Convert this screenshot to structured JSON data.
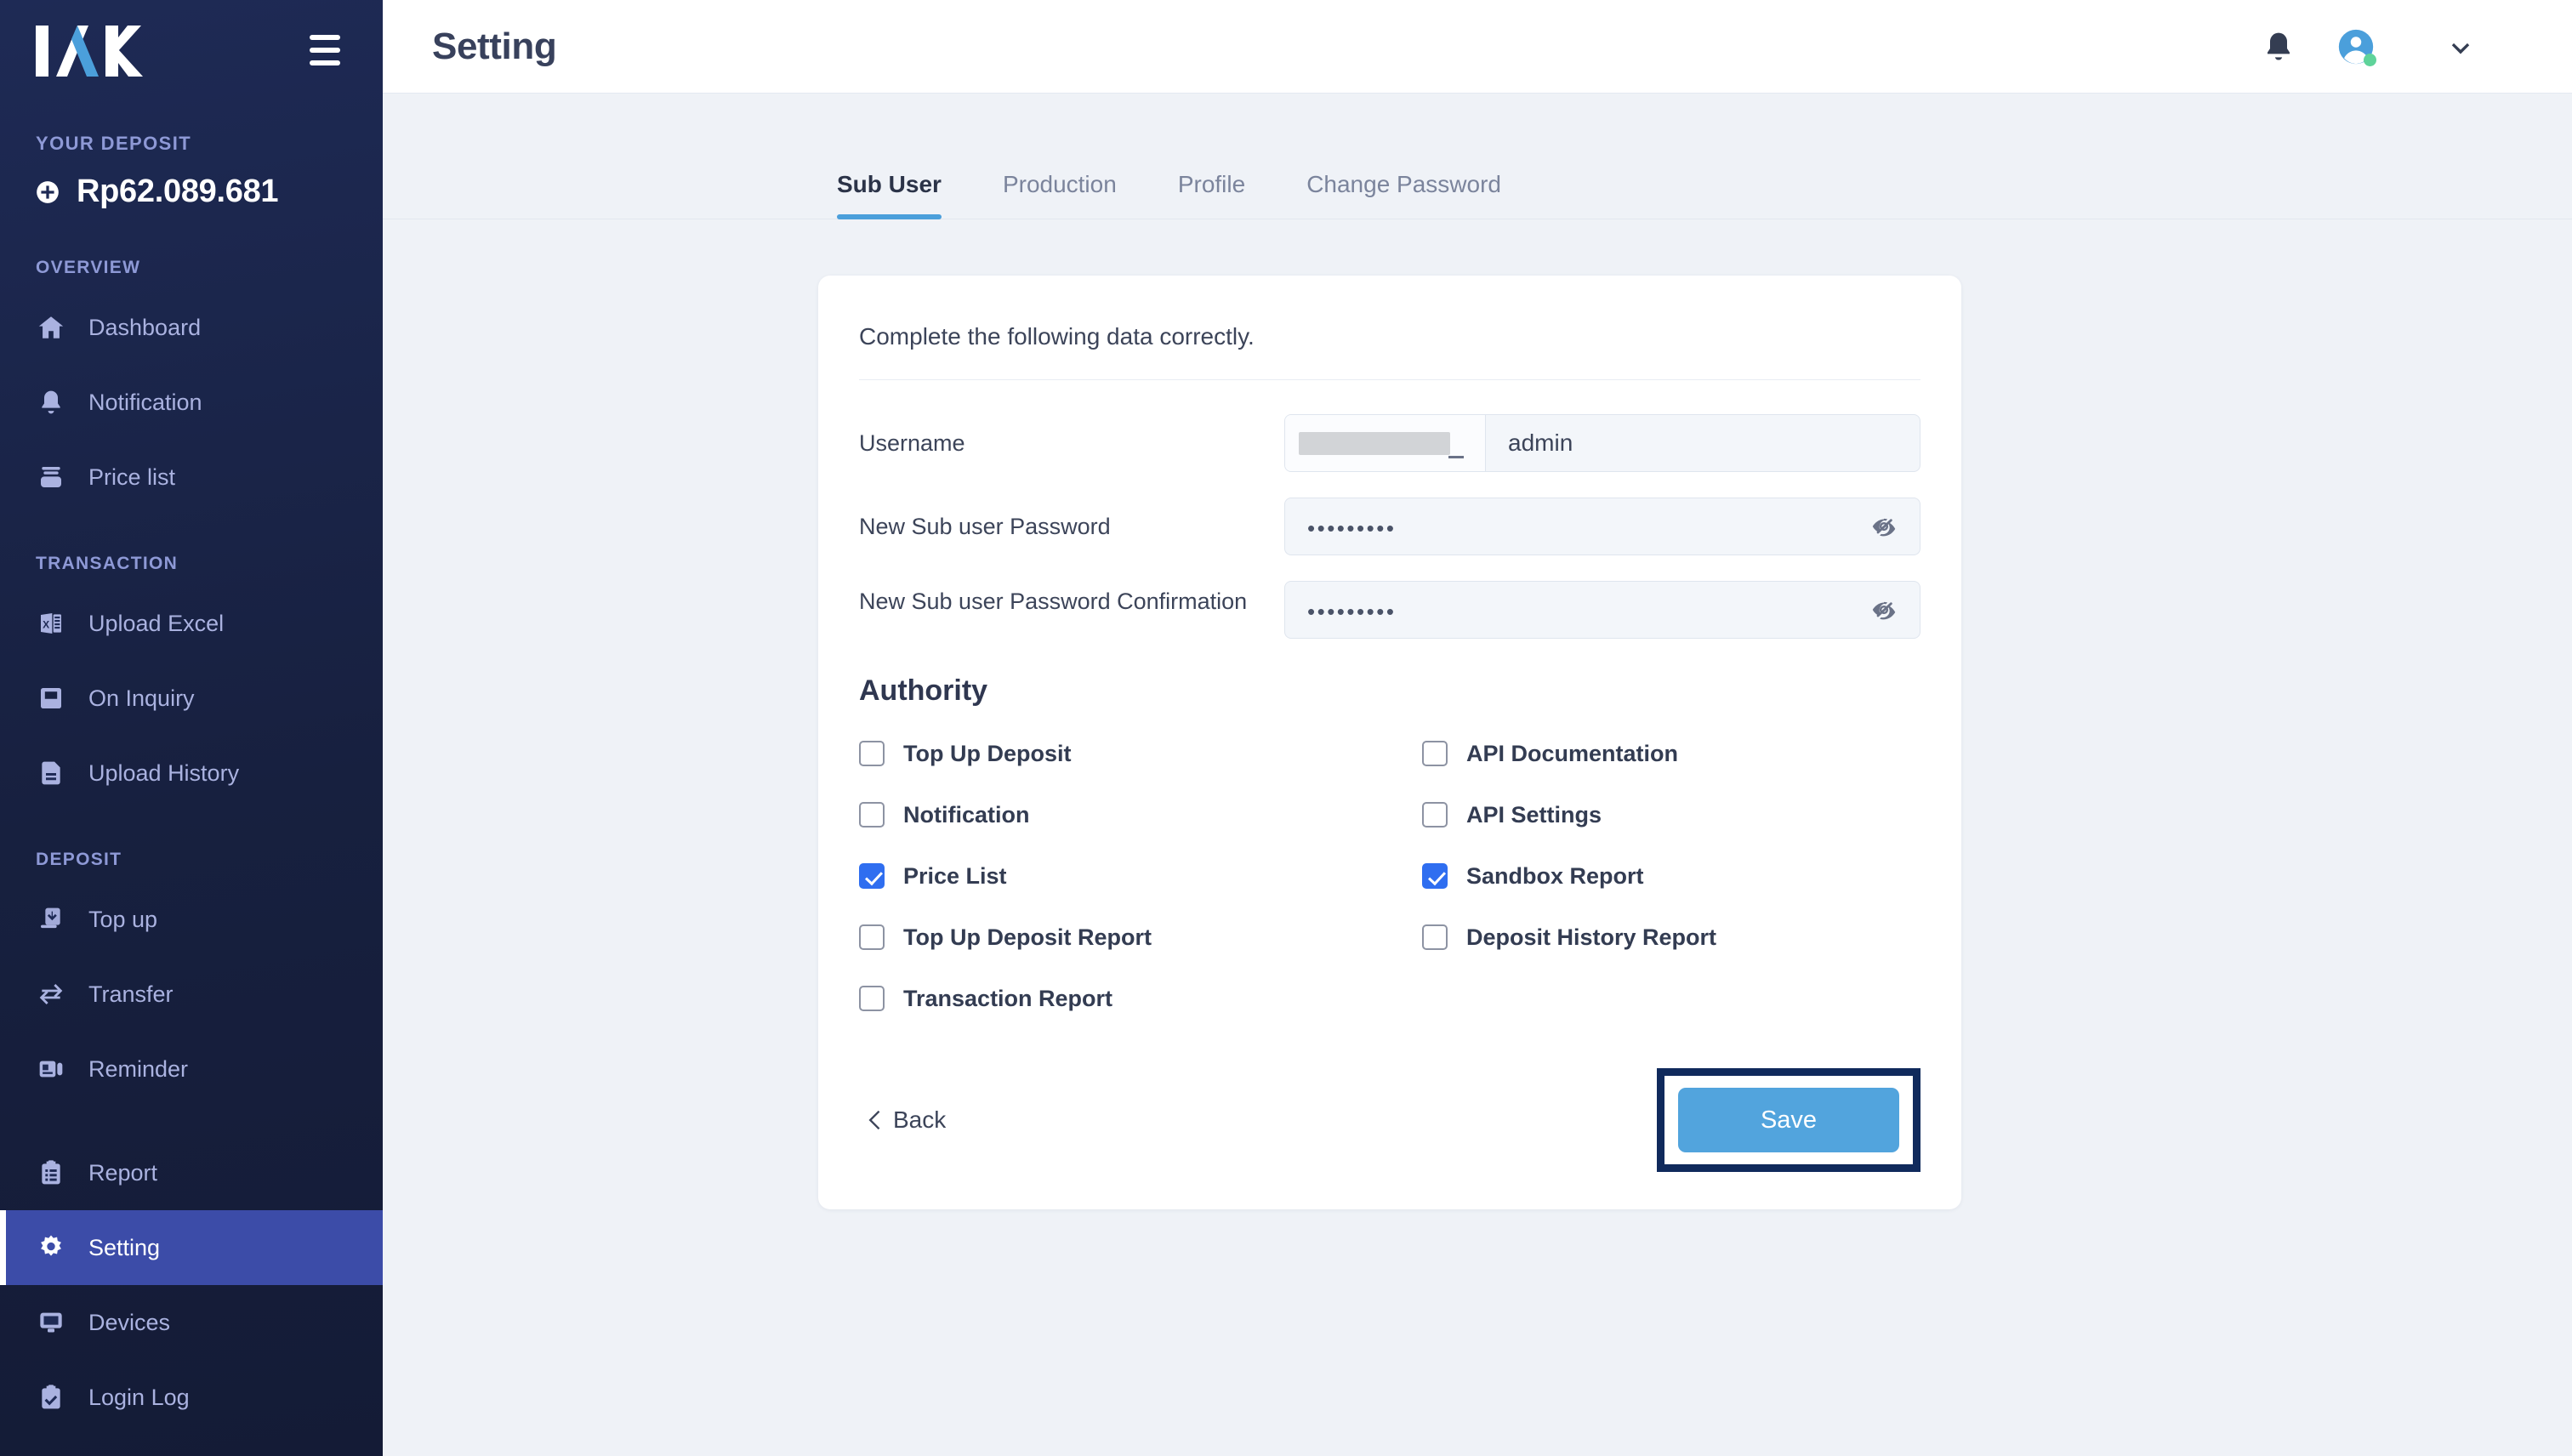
{
  "sidebar": {
    "logo_text": "IAK",
    "deposit_label": "YOUR DEPOSIT",
    "deposit_amount": "Rp62.089.681",
    "sections": [
      {
        "label": "OVERVIEW"
      },
      {
        "label": "TRANSACTION"
      },
      {
        "label": "DEPOSIT"
      }
    ],
    "overview_items": [
      {
        "label": "Dashboard",
        "icon": "home-icon"
      },
      {
        "label": "Notification",
        "icon": "bell-icon"
      },
      {
        "label": "Price list",
        "icon": "price-tag-icon"
      }
    ],
    "transaction_items": [
      {
        "label": "Upload Excel",
        "icon": "excel-file-icon"
      },
      {
        "label": "On Inquiry",
        "icon": "inbox-icon"
      },
      {
        "label": "Upload History",
        "icon": "document-icon"
      }
    ],
    "deposit_items": [
      {
        "label": "Top up",
        "icon": "topup-inbox-icon"
      },
      {
        "label": "Transfer",
        "icon": "transfer-arrows-icon"
      },
      {
        "label": "Reminder",
        "icon": "reminder-icon"
      }
    ],
    "footer_items": [
      {
        "label": "Report",
        "icon": "clipboard-list-icon",
        "active": false
      },
      {
        "label": "Setting",
        "icon": "gear-icon",
        "active": true
      },
      {
        "label": "Devices",
        "icon": "monitor-icon",
        "active": false
      },
      {
        "label": "Login Log",
        "icon": "clipboard-check-icon",
        "active": false
      }
    ],
    "active_item": "Setting",
    "accent_active_bg": "#3c4ca8",
    "text_color": "#aab2e0"
  },
  "header": {
    "title": "Setting",
    "bell_icon": "bell-icon",
    "avatar_icon": "user-avatar-icon",
    "status_color": "#5fd39a",
    "chevron_icon": "chevron-down-icon"
  },
  "tabs": [
    {
      "label": "Sub User",
      "active": true
    },
    {
      "label": "Production",
      "active": false
    },
    {
      "label": "Profile",
      "active": false
    },
    {
      "label": "Change Password",
      "active": false
    }
  ],
  "form": {
    "intro": "Complete the following data correctly.",
    "username": {
      "label": "Username",
      "prefix_redacted": "",
      "value": "admin"
    },
    "password": {
      "label": "New Sub user Password",
      "value": "•••••••••",
      "toggle_icon": "eye-slash-icon"
    },
    "password_confirm": {
      "label": "New Sub user Password Confirmation",
      "value": "•••••••••",
      "toggle_icon": "eye-slash-icon"
    }
  },
  "authority": {
    "title": "Authority",
    "left_column": [
      {
        "label": "Top Up Deposit",
        "checked": false
      },
      {
        "label": "Notification",
        "checked": false
      },
      {
        "label": "Price List",
        "checked": true
      },
      {
        "label": "Top Up Deposit Report",
        "checked": false
      },
      {
        "label": "Transaction Report",
        "checked": false
      }
    ],
    "right_column": [
      {
        "label": "API Documentation",
        "checked": false
      },
      {
        "label": "API Settings",
        "checked": false
      },
      {
        "label": "Sandbox Report",
        "checked": true
      },
      {
        "label": "Deposit History Report",
        "checked": false
      }
    ],
    "checked_color": "#2f6ef0"
  },
  "footer": {
    "back_label": "Back",
    "back_icon": "chevron-left-icon",
    "save_label": "Save",
    "save_color": "#52a4dd",
    "highlight_color": "#102a5c"
  }
}
